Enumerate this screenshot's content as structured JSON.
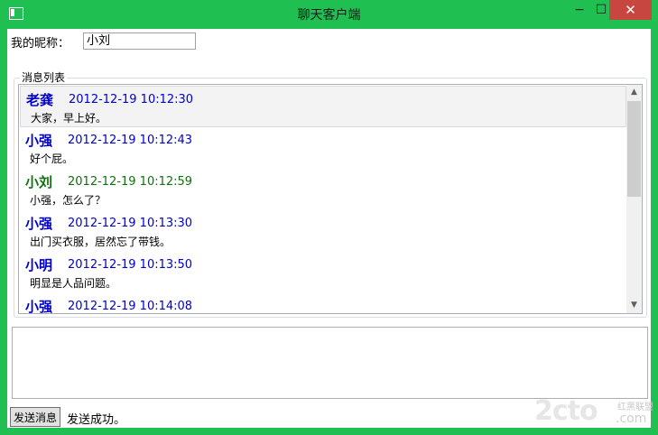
{
  "window": {
    "title": "聊天客户端",
    "minimize_glyph": "−",
    "maximize_glyph": "☐",
    "close_glyph": "✕"
  },
  "nickname": {
    "label": "我的昵称：",
    "value": "小刘"
  },
  "message_list": {
    "label": "消息列表",
    "messages": [
      {
        "sender": "老龚",
        "time": "2012-12-19 10:12:30",
        "text": "大家，早上好。",
        "color": "#0000cc"
      },
      {
        "sender": "小强",
        "time": "2012-12-19 10:12:43",
        "text": "好个屁。",
        "color": "#0000cc"
      },
      {
        "sender": "小刘",
        "time": "2012-12-19 10:12:59",
        "text": "小强，怎么了？",
        "color": "#107010"
      },
      {
        "sender": "小强",
        "time": "2012-12-19 10:13:30",
        "text": "出门买衣服，居然忘了带钱。",
        "color": "#0000cc"
      },
      {
        "sender": "小明",
        "time": "2012-12-19 10:13:50",
        "text": "明显是人品问题。",
        "color": "#0000cc"
      },
      {
        "sender": "小强",
        "time": "2012-12-19 10:14:08",
        "text": "",
        "color": "#0000cc"
      }
    ],
    "scroll_up_glyph": "▲",
    "scroll_down_glyph": "▼"
  },
  "compose": {
    "value": ""
  },
  "footer": {
    "send_label": "发送消息",
    "status": "发送成功。"
  },
  "watermark": {
    "main": "2cto",
    "sub": "红黑联盟",
    "domain": ".com"
  }
}
